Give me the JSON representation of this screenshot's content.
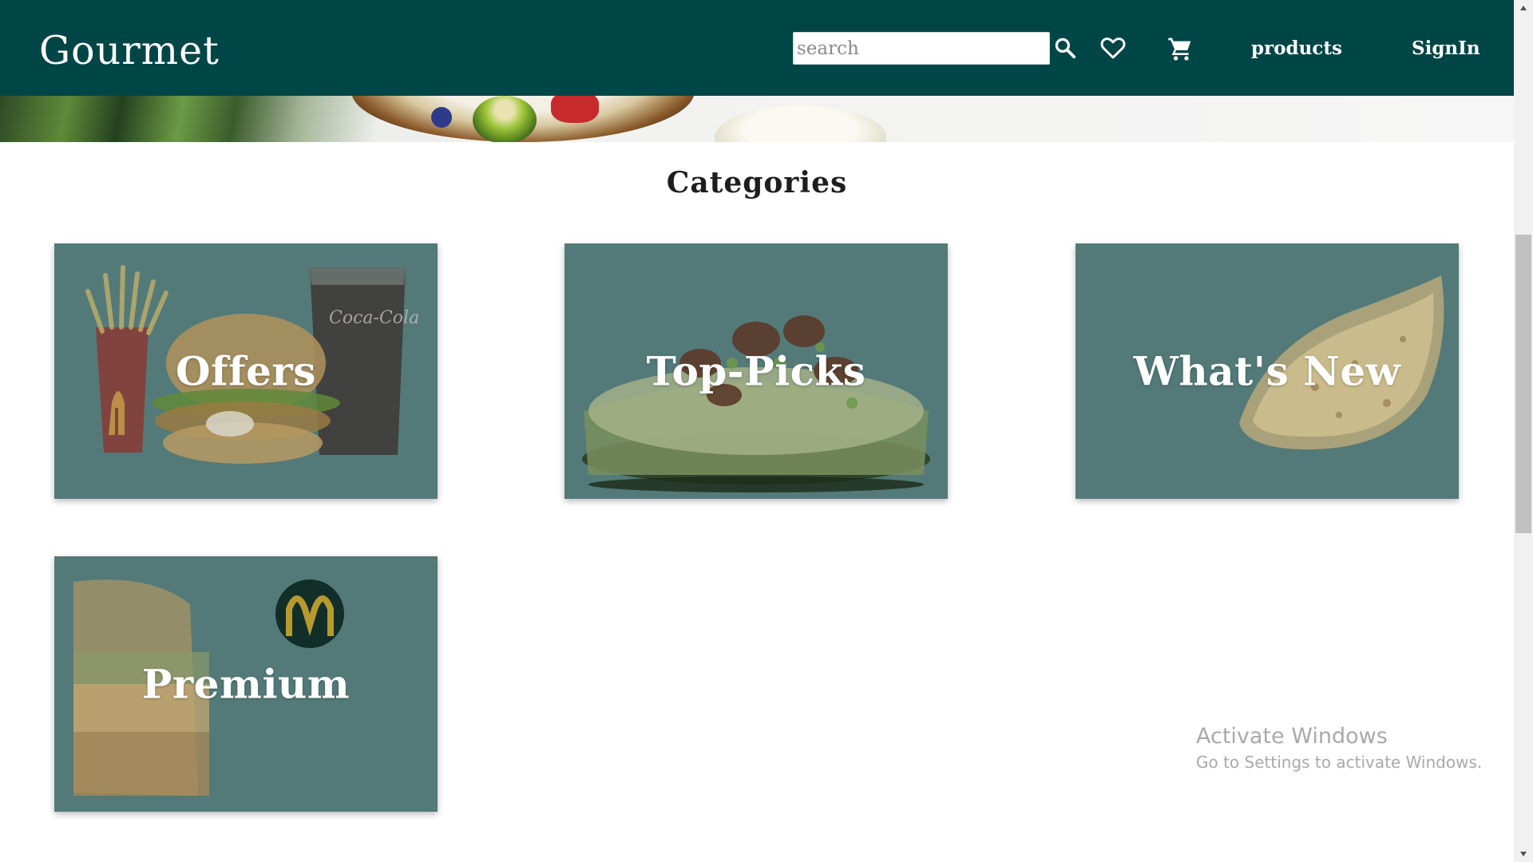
{
  "header": {
    "brand": "Gourmet",
    "search": {
      "placeholder": "search",
      "value": ""
    },
    "icons": [
      "search-icon",
      "heart-icon",
      "cart-icon"
    ],
    "nav_links": {
      "products": "products",
      "signin": "SignIn"
    }
  },
  "categories": {
    "title": "Categories",
    "cards": [
      {
        "label": "Offers"
      },
      {
        "label": "Top-Picks"
      },
      {
        "label": "What's New"
      },
      {
        "label": "Premium"
      }
    ]
  },
  "watermark": {
    "line1": "Activate Windows",
    "line2": "Go to Settings to activate Windows."
  },
  "colors": {
    "header_bg": "#004646",
    "card_overlay": "#537a78",
    "text_on_dark": "#ffffff"
  }
}
